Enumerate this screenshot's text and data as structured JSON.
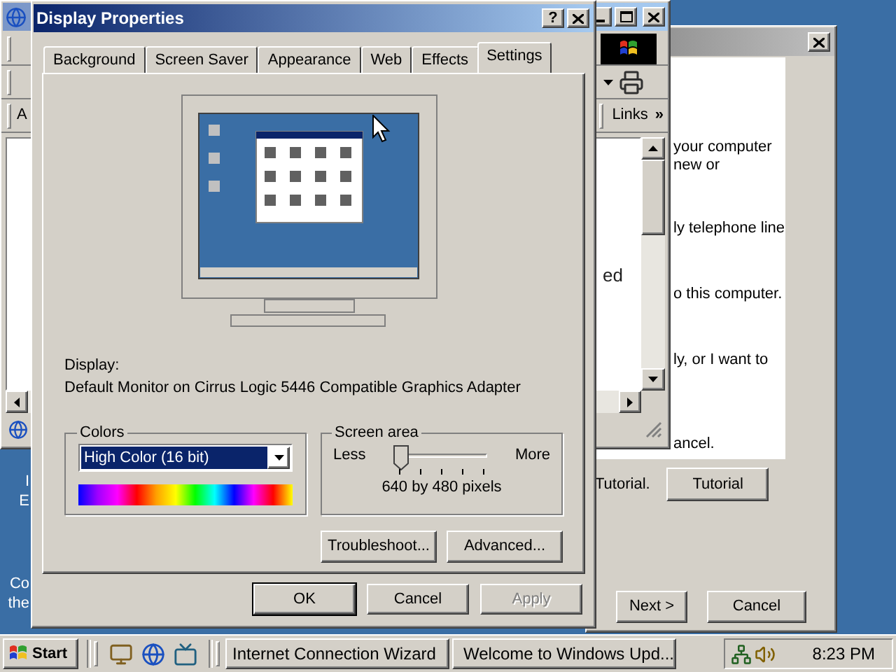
{
  "desktop": {
    "labels": [
      "I",
      "E",
      "Co",
      "the"
    ]
  },
  "browser_window": {
    "address_label": "A",
    "links": "Links",
    "links_more": "»",
    "page_text": "ed"
  },
  "wizard_window": {
    "lines": [
      "your computer",
      "new or",
      "ly telephone line",
      "o this computer.",
      "ly, or I want to",
      "ancel."
    ],
    "tutorial_text": "Tutorial.",
    "tutorial_button": "Tutorial",
    "buttons": [
      {
        "label": "Next >"
      },
      {
        "label": "Cancel"
      }
    ]
  },
  "dialog": {
    "title": "Display Properties",
    "help": "?",
    "tabs": [
      {
        "label": "Background",
        "selected": false
      },
      {
        "label": "Screen Saver",
        "selected": false
      },
      {
        "label": "Appearance",
        "selected": false
      },
      {
        "label": "Web",
        "selected": false
      },
      {
        "label": "Effects",
        "selected": false
      },
      {
        "label": "Settings",
        "selected": true
      }
    ],
    "display_label": "Display:",
    "display_value": "Default Monitor on Cirrus Logic 5446 Compatible Graphics Adapter",
    "colors": {
      "legend": "Colors",
      "value": "High Color (16 bit)"
    },
    "screen_area": {
      "legend": "Screen area",
      "less": "Less",
      "more": "More",
      "level": 0,
      "reading": "640 by 480 pixels"
    },
    "buttons": [
      {
        "label": "Troubleshoot..."
      },
      {
        "label": "Advanced..."
      }
    ],
    "footer_buttons": [
      {
        "label": "OK",
        "default": true,
        "disabled": false
      },
      {
        "label": "Cancel",
        "default": false,
        "disabled": false
      },
      {
        "label": "Apply",
        "default": false,
        "disabled": true
      }
    ]
  },
  "taskbar": {
    "start": "Start",
    "tasks": [
      {
        "label": "Internet Connection Wizard",
        "selected": false
      },
      {
        "label": "Welcome to Windows Upd...",
        "selected": false
      }
    ],
    "clock": "8:23 PM"
  }
}
